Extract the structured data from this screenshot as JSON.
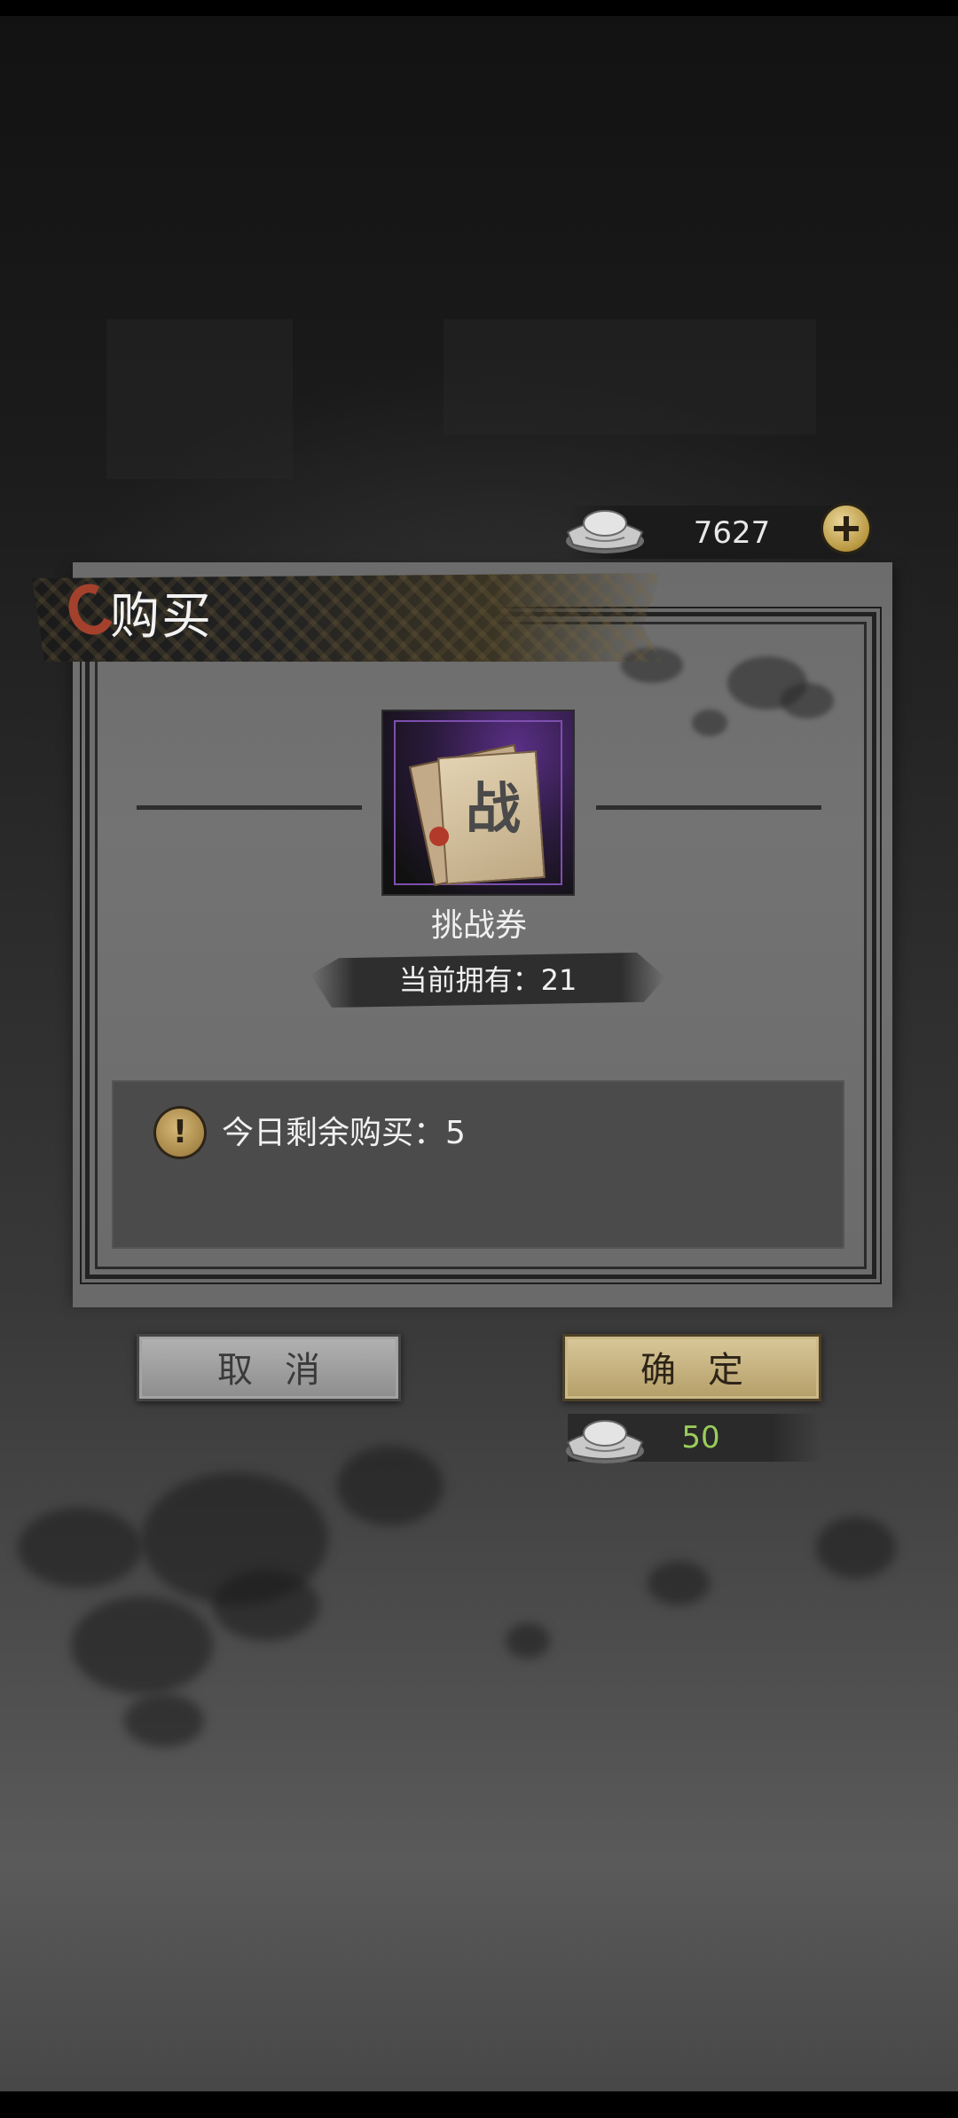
{
  "currency": {
    "icon": "silver-ingot-icon",
    "amount": "7627",
    "add_icon": "plus-icon"
  },
  "dialog": {
    "title": "购买",
    "item": {
      "icon": "challenge-ticket-icon",
      "glyph": "战",
      "name": "挑战券",
      "owned": "当前拥有：21"
    },
    "daily_limit": {
      "icon": "exclamation-icon",
      "text": "今日剩余购买：5"
    },
    "buttons": {
      "cancel": "取消",
      "confirm": "确定"
    },
    "cost": {
      "icon": "silver-ingot-icon",
      "amount": "50"
    }
  },
  "colors": {
    "confirm_button": "#cbb77f",
    "cancel_button": "#a0a0a0",
    "cost_text": "#9acd5a",
    "accent_red": "#a4412d"
  }
}
